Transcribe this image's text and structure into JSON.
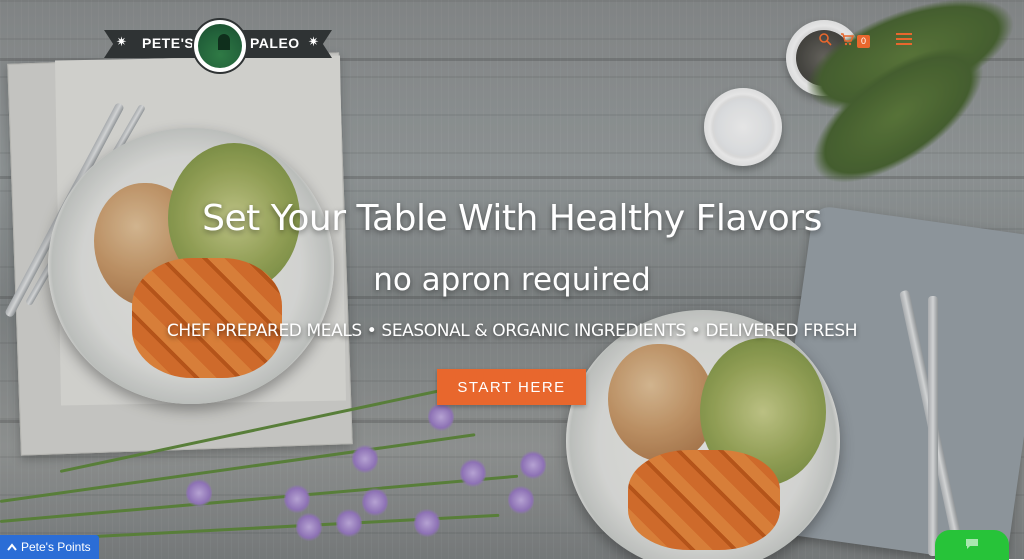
{
  "brand": {
    "name_left": "PETE'S",
    "name_right": "PALEO",
    "star": "✷"
  },
  "header": {
    "icons": [
      "search-icon",
      "cart-icon",
      "menu-icon"
    ],
    "cart_count": "0",
    "accent_color": "#e8672d"
  },
  "hero": {
    "title": "Set Your Table With Healthy Flavors",
    "subtitle": "no apron required",
    "features": "CHEF PREPARED MEALS • SEASONAL & ORGANIC INGREDIENTS • DELIVERED FRESH",
    "cta_label": "START HERE",
    "cta_color": "#e8672d"
  },
  "widgets": {
    "points_label": "Pete's Points",
    "points_icon": "chevron-up-icon",
    "points_color": "#2b6dd6",
    "chat_color": "#27c339"
  }
}
